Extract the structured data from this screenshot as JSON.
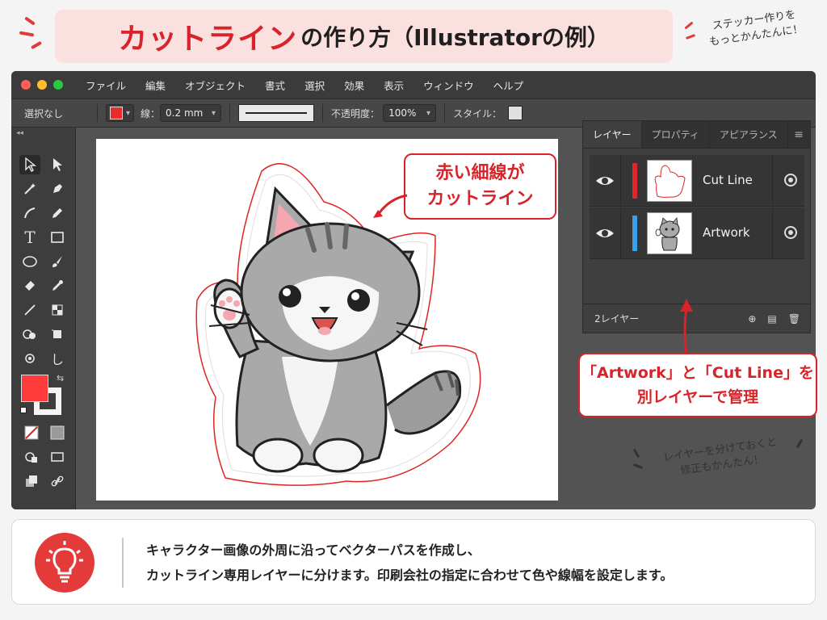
{
  "banner": {
    "title_red": "カットライン",
    "title_rest": "の作り方（Illustratorの例）"
  },
  "notes": {
    "top_right_line1": "ステッカー作りを",
    "top_right_line2": "もっとかんたんに！",
    "bottom_right_line1": "レイヤーを分けておくと",
    "bottom_right_line2": "修正もかんたん！"
  },
  "menubar": {
    "items": [
      "ファイル",
      "編集",
      "オブジェクト",
      "書式",
      "選択",
      "効果",
      "表示",
      "ウィンドウ",
      "ヘルプ"
    ]
  },
  "toolbar": {
    "selection": "選択なし",
    "stroke_label": "線：",
    "stroke_value": "0.2 mm",
    "opacity_label": "不透明度：",
    "opacity_value": "100%",
    "style_label": "スタイル："
  },
  "layers_panel": {
    "tabs": [
      "レイヤー",
      "プロパティ",
      "アピアランス"
    ],
    "layers": [
      {
        "name": "Cut Line",
        "color": "#e0252b"
      },
      {
        "name": "Artwork",
        "color": "#3aa0e8"
      }
    ],
    "footer": "2レイヤー"
  },
  "callouts": {
    "cutline_line1": "赤い細線が",
    "cutline_line2": "カットライン",
    "layers_line1": "「Artwork」と「Cut Line」を",
    "layers_line2": "別レイヤーで管理"
  },
  "info": {
    "line1": "キャラクター画像の外周に沿ってベクターパスを作成し、",
    "line2": "カットライン専用レイヤーに分けます。印刷会社の指定に合わせて色や線幅を設定します。"
  },
  "colors": {
    "accent": "#d8232a",
    "fill_swatch": "#ff3b3b"
  }
}
